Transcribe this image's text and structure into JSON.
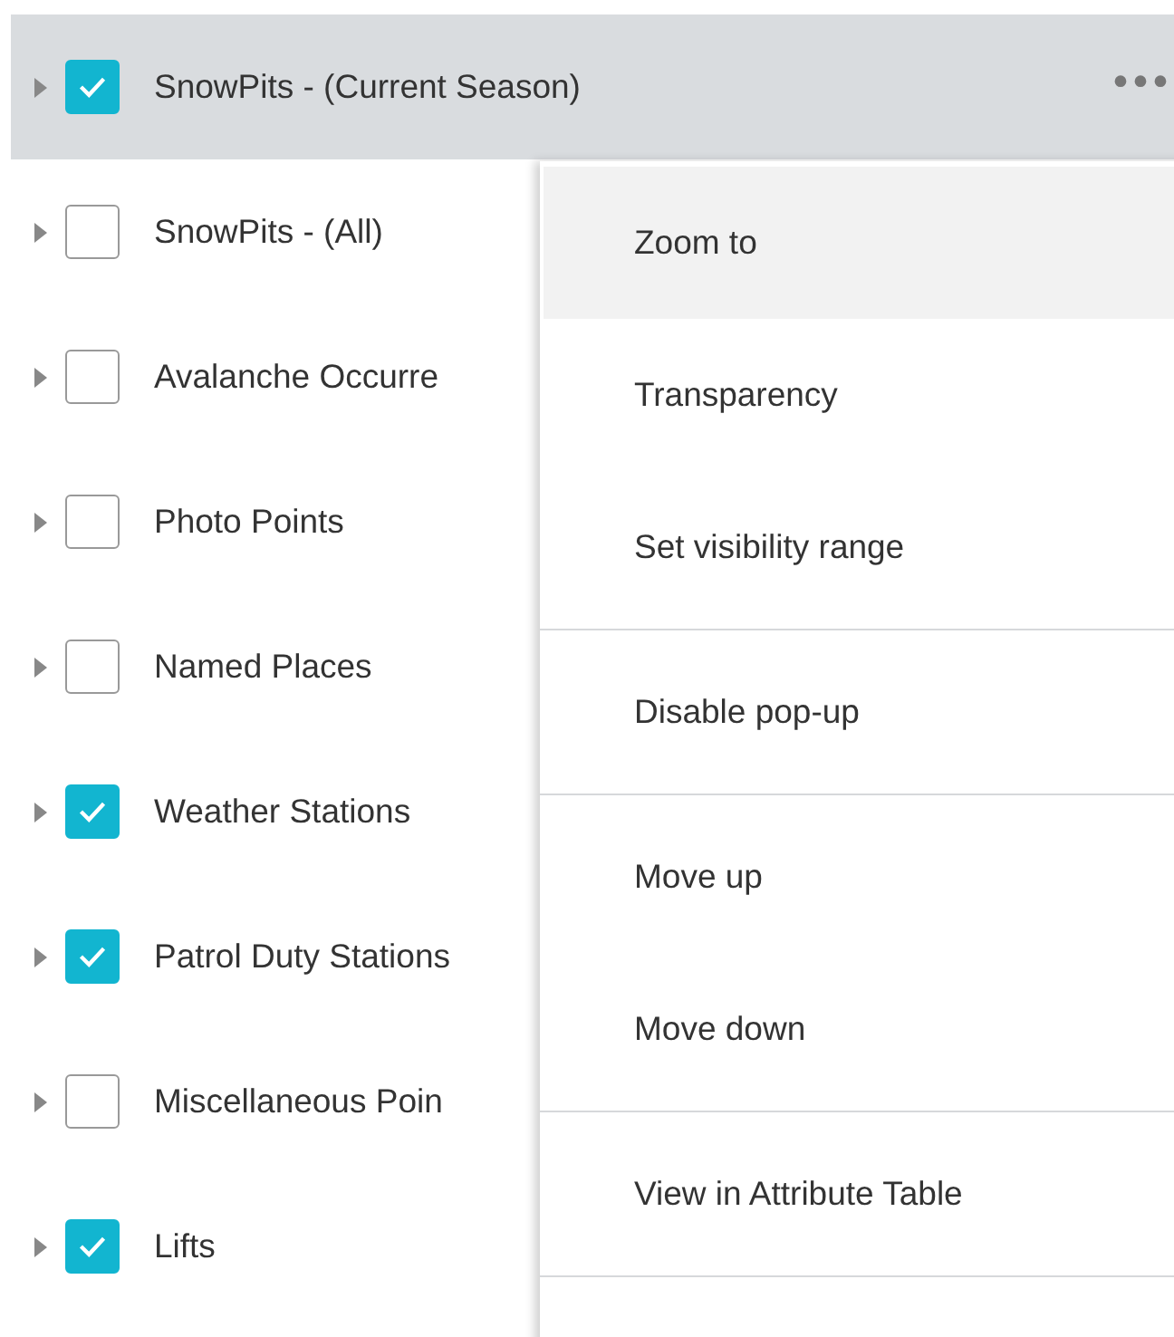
{
  "layers": [
    {
      "name": "SnowPits - (Current Season)",
      "checked": true,
      "selected": true,
      "menu_button": "•••"
    },
    {
      "name": "SnowPits - (All)",
      "checked": false,
      "selected": false
    },
    {
      "name": "Avalanche Occurre",
      "checked": false,
      "selected": false
    },
    {
      "name": "Photo Points",
      "checked": false,
      "selected": false
    },
    {
      "name": "Named Places",
      "checked": false,
      "selected": false
    },
    {
      "name": "Weather Stations",
      "checked": true,
      "selected": false
    },
    {
      "name": "Patrol Duty Stations",
      "checked": true,
      "selected": false
    },
    {
      "name": "Miscellaneous Poin",
      "checked": false,
      "selected": false
    },
    {
      "name": "Lifts",
      "checked": true,
      "selected": false
    }
  ],
  "context_menu": {
    "groups": [
      [
        {
          "label": "Zoom to",
          "selected": true
        },
        {
          "label": "Transparency",
          "selected": false
        },
        {
          "label": "Set visibility range",
          "selected": false
        }
      ],
      [
        {
          "label": "Disable pop-up",
          "selected": false
        }
      ],
      [
        {
          "label": "Move up",
          "selected": false
        },
        {
          "label": "Move down",
          "selected": false
        }
      ],
      [
        {
          "label": "View in Attribute Table",
          "selected": false
        }
      ]
    ]
  }
}
